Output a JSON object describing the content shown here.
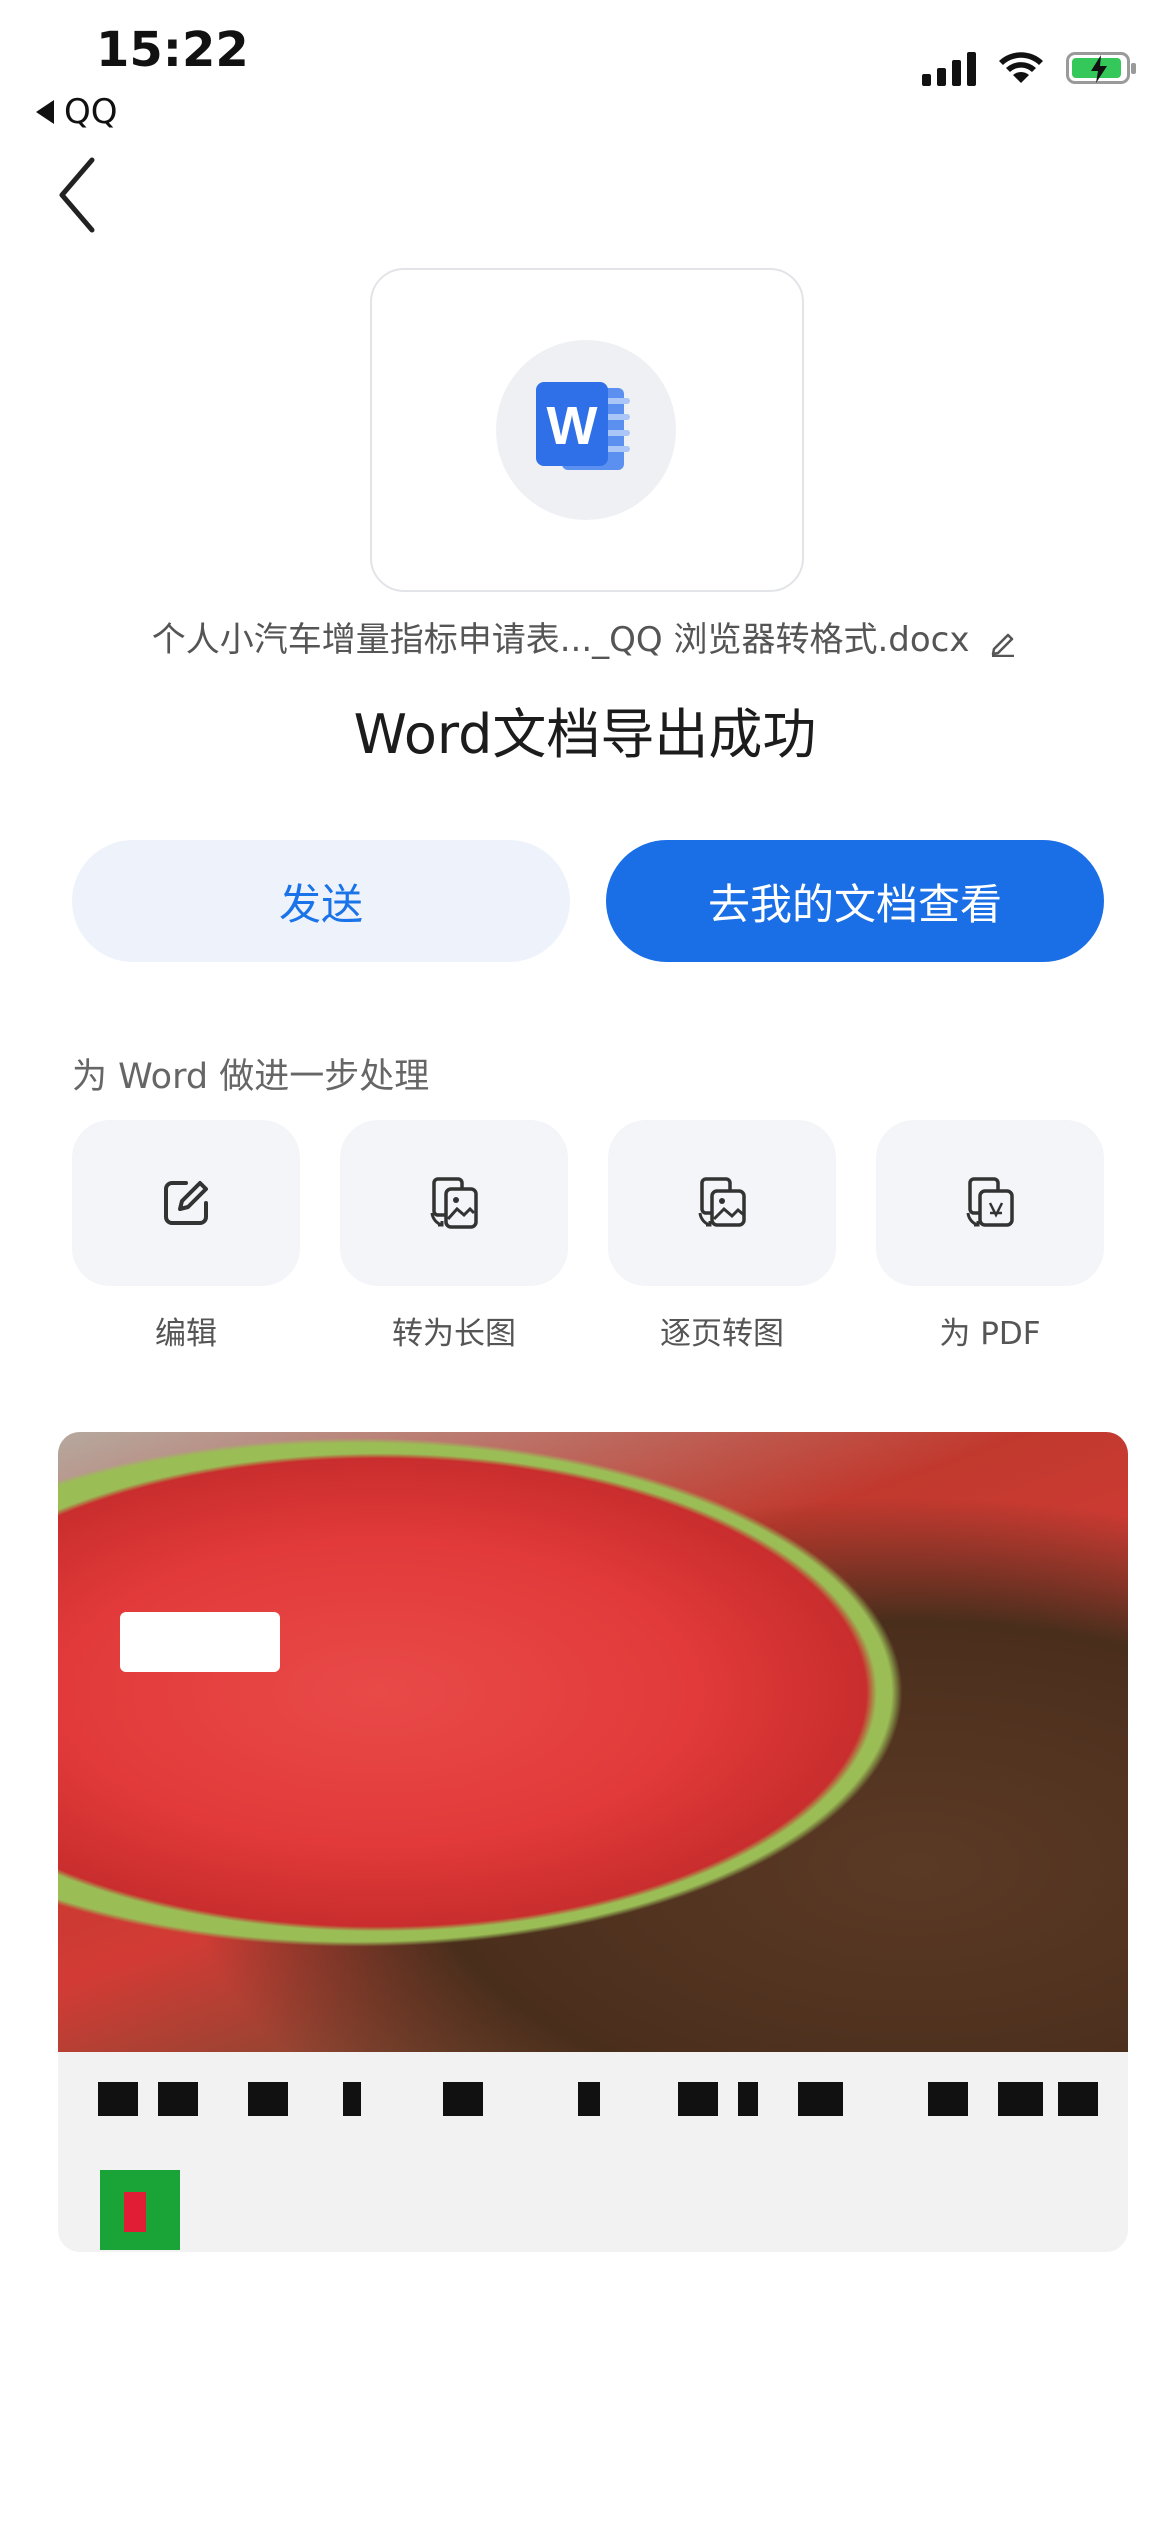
{
  "status_bar": {
    "time": "15:22",
    "back_app": "QQ"
  },
  "file": {
    "name": "个人小汽车增量指标申请表..._QQ 浏览器转格式.docx",
    "icon": "word-document-icon",
    "icon_letter": "W"
  },
  "result": {
    "title": "Word文档导出成功"
  },
  "actions": {
    "send_label": "发送",
    "docs_label": "去我的文档查看"
  },
  "tools": {
    "section_label": "为 Word 做进一步处理",
    "items": [
      {
        "label": "编辑",
        "icon": "edit-icon"
      },
      {
        "label": "转为长图",
        "icon": "long-image-icon"
      },
      {
        "label": "逐页转图",
        "icon": "page-to-image-icon"
      },
      {
        "label": "为 PDF",
        "icon": "convert-pdf-icon"
      }
    ]
  },
  "colors": {
    "accent": "#1a6ee6",
    "send_bg": "#eef3fb",
    "tile_bg": "#f4f5f8"
  }
}
